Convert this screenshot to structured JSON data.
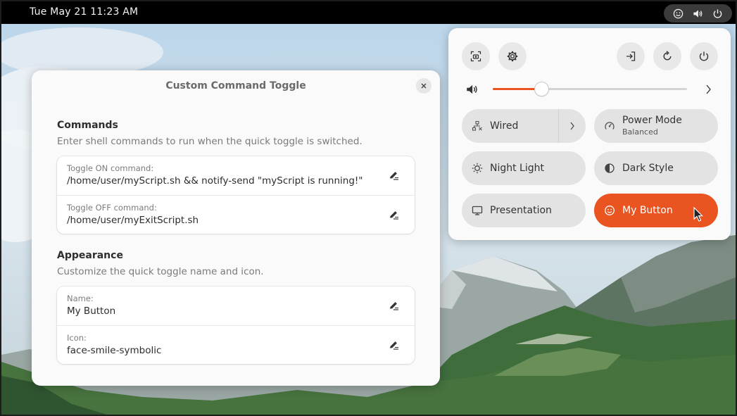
{
  "topbar": {
    "clock": "Tue May 21  11:23 AM",
    "status_icons": [
      "face-smile-icon",
      "volume-icon",
      "power-icon"
    ]
  },
  "dialog": {
    "title": "Custom Command Toggle",
    "commands": {
      "title": "Commands",
      "description": "Enter shell commands to run when the quick toggle is switched.",
      "rows": [
        {
          "label": "Toggle ON command:",
          "value": "/home/user/myScript.sh &&  notify-send \"myScript is running!\""
        },
        {
          "label": "Toggle OFF command:",
          "value": "/home/user/myExitScript.sh"
        }
      ]
    },
    "appearance": {
      "title": "Appearance",
      "description": "Customize the quick toggle name and icon.",
      "rows": [
        {
          "label": "Name:",
          "value": "My Button"
        },
        {
          "label": "Icon:",
          "value": "face-smile-symbolic"
        }
      ]
    }
  },
  "quick_settings": {
    "top_buttons": [
      "screenshot-icon",
      "settings-icon",
      "logout-icon",
      "restart-icon",
      "power-icon"
    ],
    "volume_level": 0.25,
    "accent_color": "#e95420",
    "tiles": [
      {
        "label": "Wired",
        "icon": "network-wired-icon"
      },
      {
        "label": "Power Mode",
        "subtitle": "Balanced",
        "icon": "power-mode-icon"
      },
      {
        "label": "Night Light",
        "icon": "night-light-icon"
      },
      {
        "label": "Dark Style",
        "icon": "dark-style-icon"
      },
      {
        "label": "Presentation",
        "icon": "presentation-icon"
      },
      {
        "label": "My Button",
        "icon": "face-smile-icon",
        "active": true
      }
    ]
  }
}
